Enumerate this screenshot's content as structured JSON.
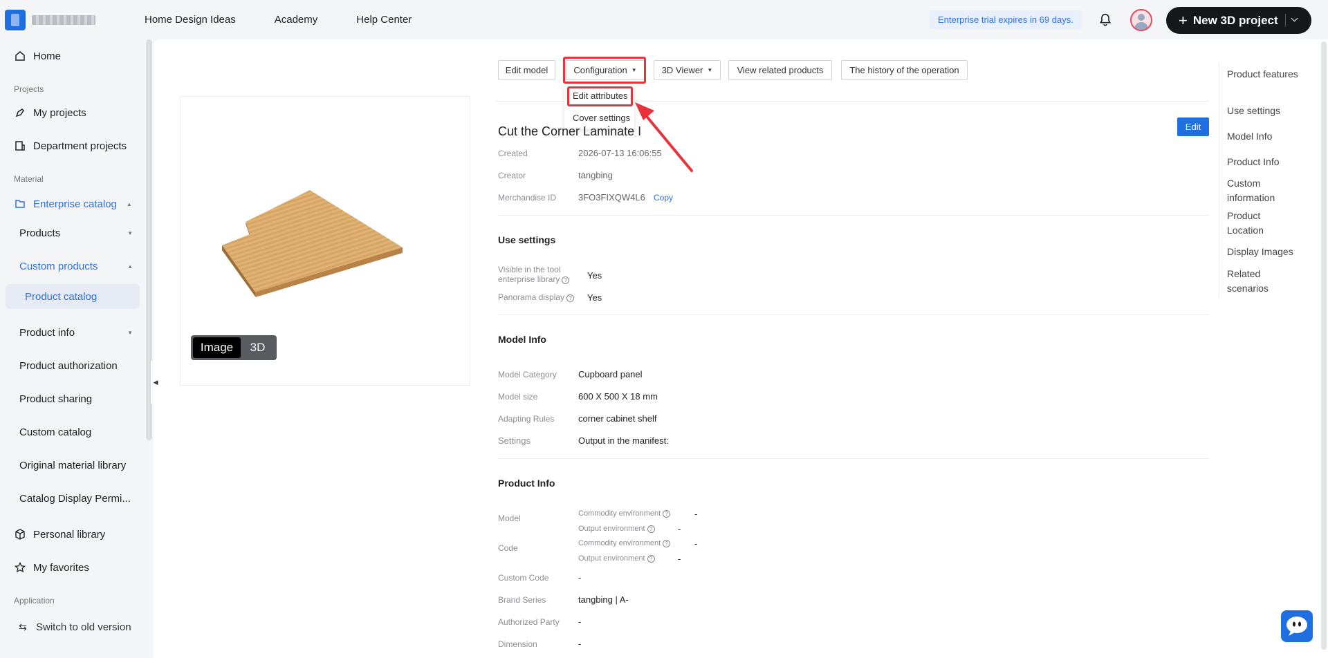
{
  "topbar": {
    "nav": [
      "Home Design Ideas",
      "Academy",
      "Help Center"
    ],
    "trial": "Enterprise trial expires in 69 days.",
    "new_project": "New 3D project"
  },
  "sidebar": {
    "home": "Home",
    "group_projects": "Projects",
    "my_projects": "My projects",
    "department_projects": "Department projects",
    "group_material": "Material",
    "enterprise_catalog": "Enterprise catalog",
    "products": "Products",
    "custom_products": "Custom products",
    "product_catalog": "Product catalog",
    "product_info": "Product info",
    "product_authorization": "Product authorization",
    "product_sharing": "Product sharing",
    "custom_catalog": "Custom catalog",
    "original_material_library": "Original material library",
    "catalog_display": "Catalog Display Permi...",
    "personal_library": "Personal library",
    "my_favorites": "My favorites",
    "group_application": "Application",
    "switch_old": "Switch to old version"
  },
  "preview": {
    "toggle_image": "Image",
    "toggle_3d": "3D"
  },
  "toolbar": {
    "edit_model": "Edit model",
    "configuration": "Configuration",
    "viewer_3d": "3D Viewer",
    "related_products": "View related products",
    "history": "The history of the operation"
  },
  "dropdown": {
    "edit_attributes": "Edit attributes",
    "cover_settings": "Cover settings"
  },
  "product": {
    "title": "Cut the Corner Laminate I",
    "edit": "Edit",
    "created_label": "Created",
    "created_value": "2026-07-13 16:06:55",
    "creator_label": "Creator",
    "creator_value": "tangbing",
    "merch_label": "Merchandise ID",
    "merch_value": "3FO3FIXQW4L6",
    "copy": "Copy"
  },
  "use_settings": {
    "title": "Use settings",
    "visible_label_1": "Visible in the tool",
    "visible_label_2": "enterprise library",
    "visible_value": "Yes",
    "panorama_label": "Panorama display",
    "panorama_value": "Yes"
  },
  "model_info": {
    "title": "Model Info",
    "category_label": "Model Category",
    "category_value": "Cupboard panel",
    "size_label": "Model size",
    "size_value": "600 X 500 X 18 mm",
    "rules_label": "Adapting Rules",
    "rules_value": "corner cabinet shelf",
    "settings_label": "Settings",
    "settings_value": "Output in the manifest:"
  },
  "product_info": {
    "title": "Product Info",
    "model_label": "Model",
    "code_label": "Code",
    "commodity_env": "Commodity environment",
    "output_env": "Output environment",
    "dash": "-",
    "custom_code_label": "Custom Code",
    "custom_code_value": "-",
    "brand_label": "Brand Series",
    "brand_value": "tangbing | A-",
    "auth_label": "Authorized Party",
    "auth_value": "-",
    "dimension_label": "Dimension",
    "dimension_value": "-"
  },
  "right_nav": [
    "Product features",
    "Use settings",
    "Model Info",
    "Product Info",
    "Custom information",
    "Product Location",
    "Display Images",
    "Related scenarios"
  ],
  "colors": {
    "accent": "#1f6fe0",
    "highlight": "#e8323c",
    "wood": "#d9a25c"
  }
}
